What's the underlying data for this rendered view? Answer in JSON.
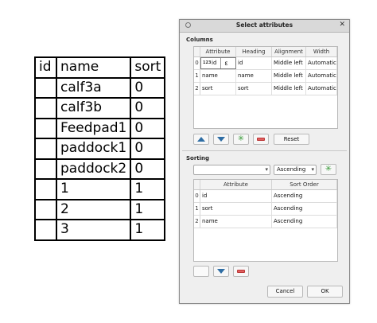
{
  "table": {
    "headers": [
      "id",
      "name",
      "sort"
    ],
    "rows": [
      [
        "",
        "calf3a",
        "0"
      ],
      [
        "",
        "calf3b",
        "0"
      ],
      [
        "",
        "Feedpad1",
        "0"
      ],
      [
        "",
        "paddock1",
        "0"
      ],
      [
        "",
        "paddock2",
        "0"
      ],
      [
        "",
        "1",
        "1"
      ],
      [
        "",
        "2",
        "1"
      ],
      [
        "",
        "3",
        "1"
      ]
    ]
  },
  "dialog": {
    "title": "Select attributes",
    "columns_section": "Columns",
    "columns_headers": [
      "Attribute",
      "Heading",
      "Alignment",
      "Width"
    ],
    "columns_rows": [
      {
        "n": "0",
        "attribute": "id",
        "heading": "id",
        "alignment": "Middle left",
        "width": "Automatic"
      },
      {
        "n": "1",
        "attribute": "name",
        "heading": "name",
        "alignment": "Middle left",
        "width": "Automatic"
      },
      {
        "n": "2",
        "attribute": "sort",
        "heading": "sort",
        "alignment": "Middle left",
        "width": "Automatic"
      }
    ],
    "editor_badge": "123",
    "editor_symbol": "ε",
    "reset_label": "Reset",
    "sorting_section": "Sorting",
    "sort_attribute_value": "",
    "sort_order_value": "Ascending",
    "sorting_headers": [
      "Attribute",
      "Sort Order"
    ],
    "sorting_rows": [
      {
        "n": "0",
        "attribute": "id",
        "order": "Ascending"
      },
      {
        "n": "1",
        "attribute": "sort",
        "order": "Ascending"
      },
      {
        "n": "2",
        "attribute": "name",
        "order": "Ascending"
      }
    ],
    "cancel_label": "Cancel",
    "ok_label": "OK"
  },
  "icons": {
    "move_up": "up-icon",
    "move_down": "down-icon",
    "add": "add-icon",
    "remove": "remove-icon",
    "dialog_menu": "window-menu-icon",
    "close": "close-icon"
  },
  "colors": {
    "arrow_blue": "#2e6da4",
    "add_green": "#3a9a3a",
    "remove_red": "#e06060"
  }
}
